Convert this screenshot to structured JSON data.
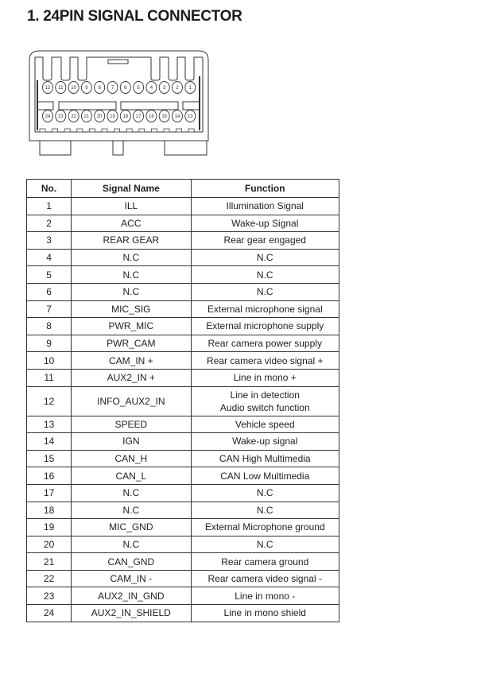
{
  "document": {
    "title": "1. 24PIN SIGNAL CONNECTOR"
  },
  "connector": {
    "top_row_pins": [
      "12",
      "11",
      "10",
      "9",
      "8",
      "7",
      "6",
      "5",
      "4",
      "3",
      "2",
      "1"
    ],
    "bottom_row_pins": [
      "24",
      "23",
      "22",
      "21",
      "20",
      "19",
      "18",
      "17",
      "16",
      "15",
      "14",
      "13"
    ]
  },
  "table": {
    "headers": {
      "no": "No.",
      "signal": "Signal Name",
      "function": "Function"
    },
    "rows": [
      {
        "no": "1",
        "signal": "ILL",
        "function": "Illumination Signal"
      },
      {
        "no": "2",
        "signal": "ACC",
        "function": "Wake-up Signal"
      },
      {
        "no": "3",
        "signal": "REAR GEAR",
        "function": "Rear gear engaged"
      },
      {
        "no": "4",
        "signal": "N.C",
        "function": "N.C"
      },
      {
        "no": "5",
        "signal": "N.C",
        "function": "N.C"
      },
      {
        "no": "6",
        "signal": "N.C",
        "function": "N.C"
      },
      {
        "no": "7",
        "signal": "MIC_SIG",
        "function": "External microphone signal"
      },
      {
        "no": "8",
        "signal": "PWR_MIC",
        "function": "External microphone supply"
      },
      {
        "no": "9",
        "signal": "PWR_CAM",
        "function": "Rear camera power supply"
      },
      {
        "no": "10",
        "signal": "CAM_IN +",
        "function": "Rear camera video signal +"
      },
      {
        "no": "11",
        "signal": "AUX2_IN +",
        "function": "Line in mono +"
      },
      {
        "no": "12",
        "signal": "INFO_AUX2_IN",
        "function": "Line in detection",
        "function_line2": "Audio switch function"
      },
      {
        "no": "13",
        "signal": "SPEED",
        "function": "Vehicle speed"
      },
      {
        "no": "14",
        "signal": "IGN",
        "function": "Wake-up signal"
      },
      {
        "no": "15",
        "signal": "CAN_H",
        "function": "CAN High Multimedia"
      },
      {
        "no": "16",
        "signal": "CAN_L",
        "function": "CAN Low Multimedia"
      },
      {
        "no": "17",
        "signal": "N.C",
        "function": "N.C"
      },
      {
        "no": "18",
        "signal": "N.C",
        "function": "N.C"
      },
      {
        "no": "19",
        "signal": "MIC_GND",
        "function": "External Microphone ground"
      },
      {
        "no": "20",
        "signal": "N.C",
        "function": "N.C"
      },
      {
        "no": "21",
        "signal": "CAN_GND",
        "function": "Rear camera ground"
      },
      {
        "no": "22",
        "signal": "CAM_IN -",
        "function": "Rear camera video signal -"
      },
      {
        "no": "23",
        "signal": "AUX2_IN_GND",
        "function": "Line in mono -"
      },
      {
        "no": "24",
        "signal": "AUX2_IN_SHIELD",
        "function": "Line in mono shield"
      }
    ]
  }
}
